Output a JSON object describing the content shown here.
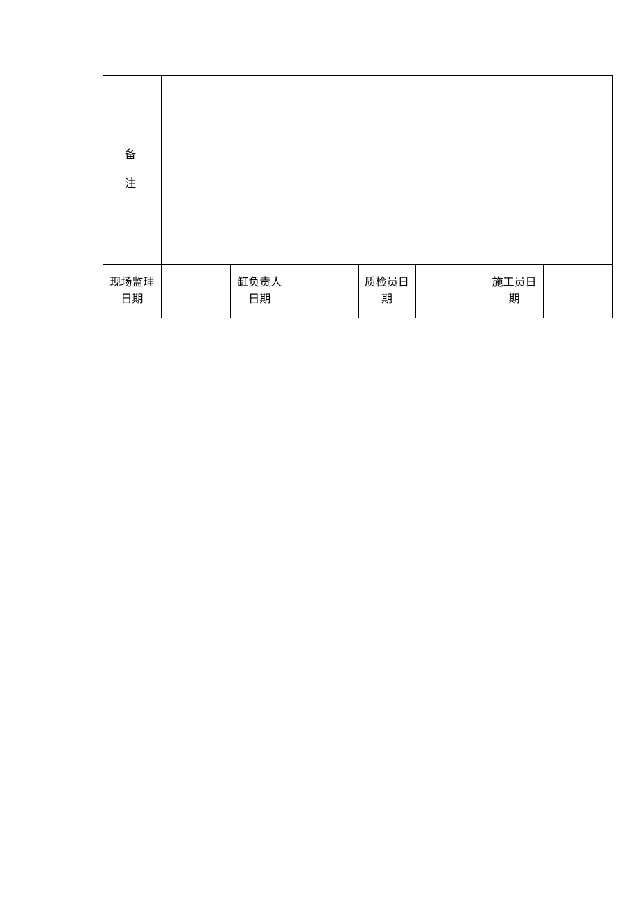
{
  "remark": {
    "label_line1": "备",
    "label_line2": "注",
    "content": ""
  },
  "signatures": {
    "col1": {
      "label": "现场监理日期",
      "value": ""
    },
    "col2": {
      "label": "缸负责人日期",
      "value": ""
    },
    "col3": {
      "label": "质检员日期",
      "value": ""
    },
    "col4": {
      "label": "施工员日期",
      "value": ""
    }
  }
}
